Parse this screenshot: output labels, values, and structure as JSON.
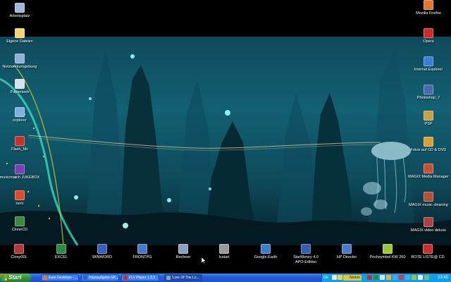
{
  "desktop": {
    "left_icons": [
      {
        "label": "Arbeitsplatz",
        "icon": "computer-icon",
        "color": "#9fb7d8"
      },
      {
        "label": "Eigene Dateien",
        "icon": "documents-folder-icon",
        "color": "#f3d36b"
      },
      {
        "label": "Netzwerkumgebung",
        "icon": "network-icon",
        "color": "#8fb0d6"
      },
      {
        "label": "Papierkorb",
        "icon": "recycle-bin-icon",
        "color": "#d7e2ec"
      },
      {
        "label": "explorer",
        "icon": "explorer-icon",
        "color": "#7fb0e0"
      },
      {
        "label": "Flash_Mx",
        "icon": "flash-icon",
        "color": "#c8302a"
      },
      {
        "label": "musicmatch JUKEBOX",
        "icon": "jukebox-icon",
        "color": "#7a3fb0"
      },
      {
        "label": "nero",
        "icon": "nero-icon",
        "color": "#e04a2a"
      },
      {
        "label": "CloneCD",
        "icon": "clonecd-icon",
        "color": "#3a8a3a"
      }
    ],
    "right_icons": [
      {
        "label": "Mozilla Firefox",
        "icon": "firefox-icon",
        "color": "#e07a2a"
      },
      {
        "label": "Opera",
        "icon": "opera-icon",
        "color": "#d22a2a"
      },
      {
        "label": "Internet Explorer",
        "icon": "internet-explorer-icon",
        "color": "#3a7ed8"
      },
      {
        "label": "Photoshop_7",
        "icon": "photoshop-icon",
        "color": "#4a6ab0"
      },
      {
        "label": "PSP",
        "icon": "psp-icon",
        "color": "#c8a040"
      },
      {
        "label": "Fotos auf CD & DVD",
        "icon": "photos-cd-icon",
        "color": "#d8a030"
      },
      {
        "label": "MAGIX Media Manager",
        "icon": "magix-media-icon",
        "color": "#c85030"
      },
      {
        "label": "MAGIX music cleaning",
        "icon": "magix-music-icon",
        "color": "#b05030"
      },
      {
        "label": "MAGIX video deluxe",
        "icon": "magix-video-icon",
        "color": "#b04040"
      }
    ],
    "bottom_icons": [
      {
        "label": "Clony00L",
        "icon": "clony-icon",
        "color": "#b03a3a"
      },
      {
        "label": "EXCEL",
        "icon": "excel-icon",
        "color": "#2f8a3f"
      },
      {
        "label": "WINWORD",
        "icon": "word-icon",
        "color": "#3a5fb8"
      },
      {
        "label": "FRONTPG",
        "icon": "frontpage-icon",
        "color": "#4a78c8"
      },
      {
        "label": "Rechner",
        "icon": "calculator-icon",
        "color": "#8aa0c0"
      },
      {
        "label": "Icstart",
        "icon": "icstart-icon",
        "color": "#9a9a9a"
      },
      {
        "label": "Google Earth",
        "icon": "google-earth-icon",
        "color": "#3a80c8"
      },
      {
        "label": "StarMoney 4.0\nAPO-Edition",
        "icon": "starmoney-icon",
        "color": "#3060b0"
      },
      {
        "label": "HP Director",
        "icon": "hp-director-icon",
        "color": "#4a7ac8"
      },
      {
        "label": "Pechsymbol KW 260",
        "icon": "pechsymbol-icon",
        "color": "#9ac83a"
      },
      {
        "label": "ROTE LISTE@ CD",
        "icon": "rote-liste-icon",
        "color": "#c83030"
      }
    ]
  },
  "taskbar": {
    "start_label": "Start",
    "tasks": [
      {
        "label": "Eure Desktops - ...",
        "icon": "browser-task-icon",
        "color": "#e07a2a",
        "active": false
      },
      {
        "label": "Hausaufgabe GK...",
        "icon": "document-task-icon",
        "color": "#3a5fb8",
        "active": false
      },
      {
        "label": "FLV Player 1.3.3",
        "icon": "flv-player-task-icon",
        "color": "#c83030",
        "active": false
      },
      {
        "label": "'Lore Of The Lo...",
        "icon": "player-task-icon",
        "color": "#8aa0c0",
        "active": true
      }
    ],
    "tray": {
      "language": "DE",
      "norton_label": "Norton",
      "clock": "23:40"
    }
  },
  "colors": {
    "taskbar": "#245edb",
    "start_button": "#3c9a3c",
    "tray": "#0f9ff0"
  }
}
